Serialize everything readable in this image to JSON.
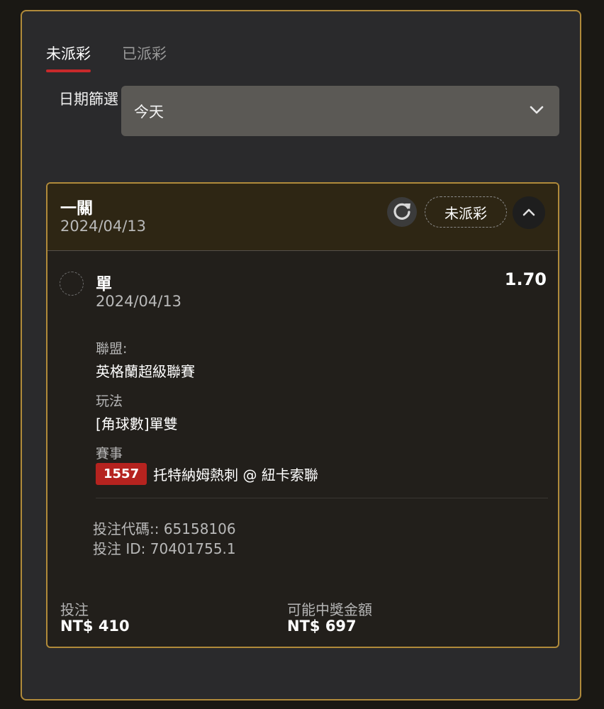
{
  "tabs": [
    {
      "label": "未派彩",
      "active": true
    },
    {
      "label": "已派彩",
      "active": false
    }
  ],
  "filter": {
    "label": "日期篩選",
    "value": "今天"
  },
  "bet_card": {
    "title": "一關",
    "date": "2024/04/13",
    "status": "未派彩",
    "selection": {
      "type": "單",
      "odds": "1.70",
      "date": "2024/04/13",
      "league_label": "聯盟:",
      "league": "英格蘭超級聯賽",
      "play_label": "玩法",
      "play": "[角球數]單雙",
      "event_label": "賽事",
      "event_id": "1557",
      "event": "托特納姆熱刺 @ 紐卡索聯"
    },
    "bet_code": "投注代碼:: 65158106",
    "bet_id": "投注 ID: 70401755.1",
    "stake_label": "投注",
    "stake": "NT$ 410",
    "payout_label": "可能中獎金額",
    "payout": "NT$ 697"
  },
  "colors": {
    "accent_border": "#b08a3a",
    "active_tab_underline": "#c8292b",
    "event_badge": "#b5231f"
  },
  "icons": {
    "dropdown": "chevron-down-icon",
    "refresh": "refresh-icon",
    "collapse": "chevron-up-icon"
  }
}
